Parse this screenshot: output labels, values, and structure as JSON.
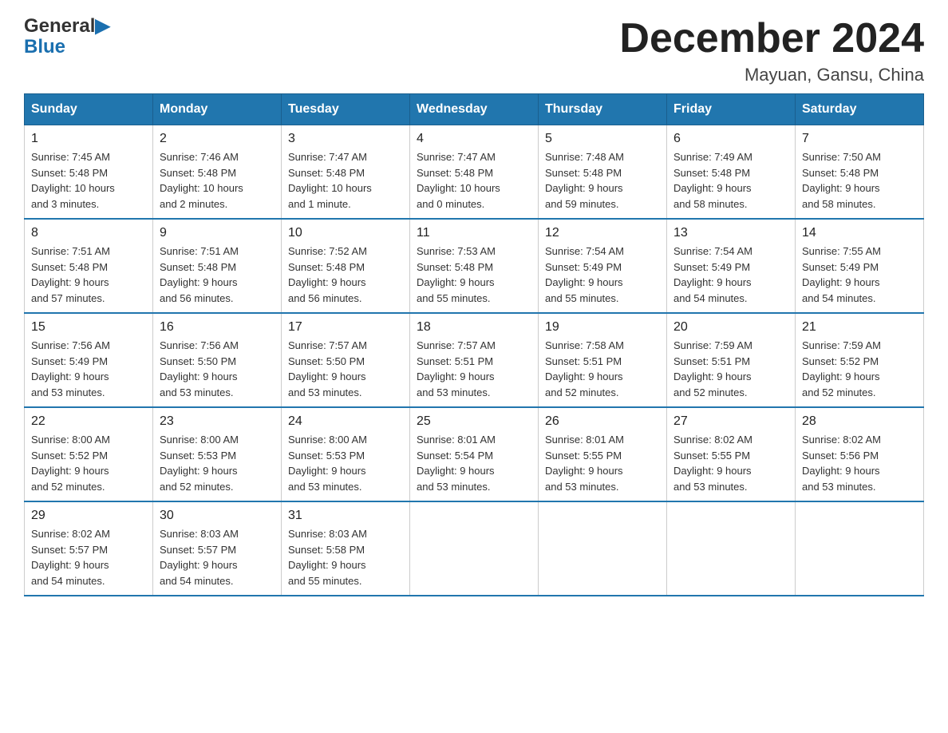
{
  "logo": {
    "text_general": "General",
    "text_blue": "Blue",
    "icon_label": "general-blue-logo-icon"
  },
  "title": "December 2024",
  "location": "Mayuan, Gansu, China",
  "days_of_week": [
    "Sunday",
    "Monday",
    "Tuesday",
    "Wednesday",
    "Thursday",
    "Friday",
    "Saturday"
  ],
  "weeks": [
    [
      {
        "day": "1",
        "info": "Sunrise: 7:45 AM\nSunset: 5:48 PM\nDaylight: 10 hours\nand 3 minutes."
      },
      {
        "day": "2",
        "info": "Sunrise: 7:46 AM\nSunset: 5:48 PM\nDaylight: 10 hours\nand 2 minutes."
      },
      {
        "day": "3",
        "info": "Sunrise: 7:47 AM\nSunset: 5:48 PM\nDaylight: 10 hours\nand 1 minute."
      },
      {
        "day": "4",
        "info": "Sunrise: 7:47 AM\nSunset: 5:48 PM\nDaylight: 10 hours\nand 0 minutes."
      },
      {
        "day": "5",
        "info": "Sunrise: 7:48 AM\nSunset: 5:48 PM\nDaylight: 9 hours\nand 59 minutes."
      },
      {
        "day": "6",
        "info": "Sunrise: 7:49 AM\nSunset: 5:48 PM\nDaylight: 9 hours\nand 58 minutes."
      },
      {
        "day": "7",
        "info": "Sunrise: 7:50 AM\nSunset: 5:48 PM\nDaylight: 9 hours\nand 58 minutes."
      }
    ],
    [
      {
        "day": "8",
        "info": "Sunrise: 7:51 AM\nSunset: 5:48 PM\nDaylight: 9 hours\nand 57 minutes."
      },
      {
        "day": "9",
        "info": "Sunrise: 7:51 AM\nSunset: 5:48 PM\nDaylight: 9 hours\nand 56 minutes."
      },
      {
        "day": "10",
        "info": "Sunrise: 7:52 AM\nSunset: 5:48 PM\nDaylight: 9 hours\nand 56 minutes."
      },
      {
        "day": "11",
        "info": "Sunrise: 7:53 AM\nSunset: 5:48 PM\nDaylight: 9 hours\nand 55 minutes."
      },
      {
        "day": "12",
        "info": "Sunrise: 7:54 AM\nSunset: 5:49 PM\nDaylight: 9 hours\nand 55 minutes."
      },
      {
        "day": "13",
        "info": "Sunrise: 7:54 AM\nSunset: 5:49 PM\nDaylight: 9 hours\nand 54 minutes."
      },
      {
        "day": "14",
        "info": "Sunrise: 7:55 AM\nSunset: 5:49 PM\nDaylight: 9 hours\nand 54 minutes."
      }
    ],
    [
      {
        "day": "15",
        "info": "Sunrise: 7:56 AM\nSunset: 5:49 PM\nDaylight: 9 hours\nand 53 minutes."
      },
      {
        "day": "16",
        "info": "Sunrise: 7:56 AM\nSunset: 5:50 PM\nDaylight: 9 hours\nand 53 minutes."
      },
      {
        "day": "17",
        "info": "Sunrise: 7:57 AM\nSunset: 5:50 PM\nDaylight: 9 hours\nand 53 minutes."
      },
      {
        "day": "18",
        "info": "Sunrise: 7:57 AM\nSunset: 5:51 PM\nDaylight: 9 hours\nand 53 minutes."
      },
      {
        "day": "19",
        "info": "Sunrise: 7:58 AM\nSunset: 5:51 PM\nDaylight: 9 hours\nand 52 minutes."
      },
      {
        "day": "20",
        "info": "Sunrise: 7:59 AM\nSunset: 5:51 PM\nDaylight: 9 hours\nand 52 minutes."
      },
      {
        "day": "21",
        "info": "Sunrise: 7:59 AM\nSunset: 5:52 PM\nDaylight: 9 hours\nand 52 minutes."
      }
    ],
    [
      {
        "day": "22",
        "info": "Sunrise: 8:00 AM\nSunset: 5:52 PM\nDaylight: 9 hours\nand 52 minutes."
      },
      {
        "day": "23",
        "info": "Sunrise: 8:00 AM\nSunset: 5:53 PM\nDaylight: 9 hours\nand 52 minutes."
      },
      {
        "day": "24",
        "info": "Sunrise: 8:00 AM\nSunset: 5:53 PM\nDaylight: 9 hours\nand 53 minutes."
      },
      {
        "day": "25",
        "info": "Sunrise: 8:01 AM\nSunset: 5:54 PM\nDaylight: 9 hours\nand 53 minutes."
      },
      {
        "day": "26",
        "info": "Sunrise: 8:01 AM\nSunset: 5:55 PM\nDaylight: 9 hours\nand 53 minutes."
      },
      {
        "day": "27",
        "info": "Sunrise: 8:02 AM\nSunset: 5:55 PM\nDaylight: 9 hours\nand 53 minutes."
      },
      {
        "day": "28",
        "info": "Sunrise: 8:02 AM\nSunset: 5:56 PM\nDaylight: 9 hours\nand 53 minutes."
      }
    ],
    [
      {
        "day": "29",
        "info": "Sunrise: 8:02 AM\nSunset: 5:57 PM\nDaylight: 9 hours\nand 54 minutes."
      },
      {
        "day": "30",
        "info": "Sunrise: 8:03 AM\nSunset: 5:57 PM\nDaylight: 9 hours\nand 54 minutes."
      },
      {
        "day": "31",
        "info": "Sunrise: 8:03 AM\nSunset: 5:58 PM\nDaylight: 9 hours\nand 55 minutes."
      },
      null,
      null,
      null,
      null
    ]
  ]
}
